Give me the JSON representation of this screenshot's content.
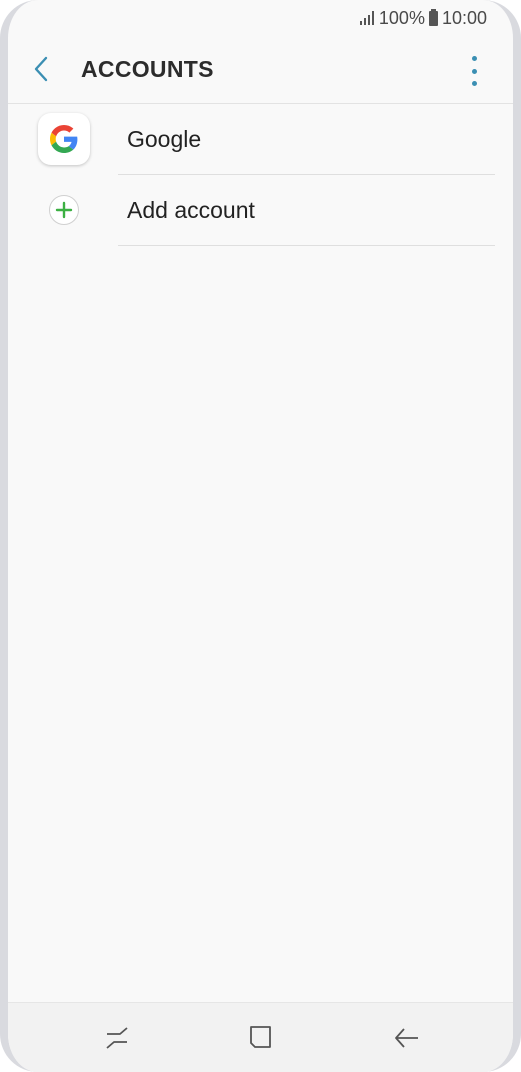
{
  "status_bar": {
    "battery": "100%",
    "time": "10:00"
  },
  "header": {
    "title": "ACCOUNTS"
  },
  "accounts": [
    {
      "label": "Google",
      "icon": "google-icon"
    },
    {
      "label": "Add account",
      "icon": "plus-icon"
    }
  ],
  "colors": {
    "accent": "#3b8fb3",
    "add_green": "#3cb043"
  }
}
